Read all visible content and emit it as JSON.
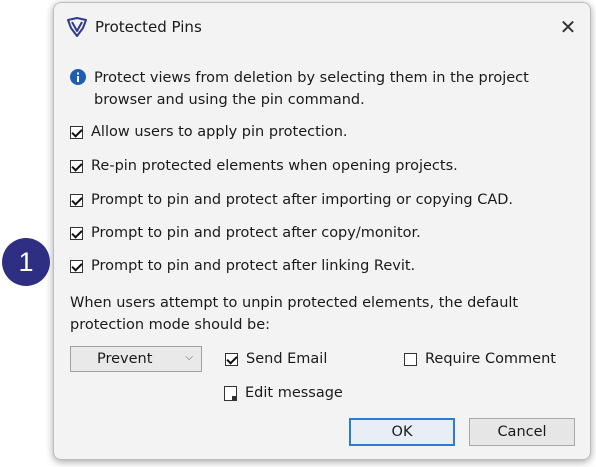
{
  "dialog": {
    "title": "Protected Pins",
    "close_glyph": "✕",
    "info_text": "Protect views from deletion by selecting them in the project browser and using the pin command.",
    "options": [
      {
        "label": "Allow users to apply pin protection.",
        "checked": true
      },
      {
        "label": "Re-pin protected elements when opening projects.",
        "checked": true
      },
      {
        "label": "Prompt to pin and protect after importing or copying CAD.",
        "checked": true
      },
      {
        "label": "Prompt to pin and protect after copy/monitor.",
        "checked": true
      },
      {
        "label": "Prompt to pin and protect after linking Revit.",
        "checked": true
      }
    ],
    "mode_text": "When users attempt to unpin protected elements, the default protection mode should be:",
    "mode_select": {
      "value": "Prevent"
    },
    "send_email": {
      "label": "Send Email",
      "checked": true
    },
    "require_comment": {
      "label": "Require Comment",
      "checked": false
    },
    "edit_message": {
      "label": "Edit message"
    },
    "ok_label": "OK",
    "cancel_label": "Cancel"
  },
  "annotation": {
    "step": "1"
  },
  "colors": {
    "badge": "#2e2f82",
    "accent": "#2b7cd3",
    "dialog_bg": "#f3f3f3",
    "info_icon": "#1f5fb0"
  },
  "icons": {
    "app": "shield-v-icon",
    "info": "info-icon",
    "close": "close-icon",
    "dropdown": "chevron-down-icon",
    "edit": "document-edit-icon"
  }
}
